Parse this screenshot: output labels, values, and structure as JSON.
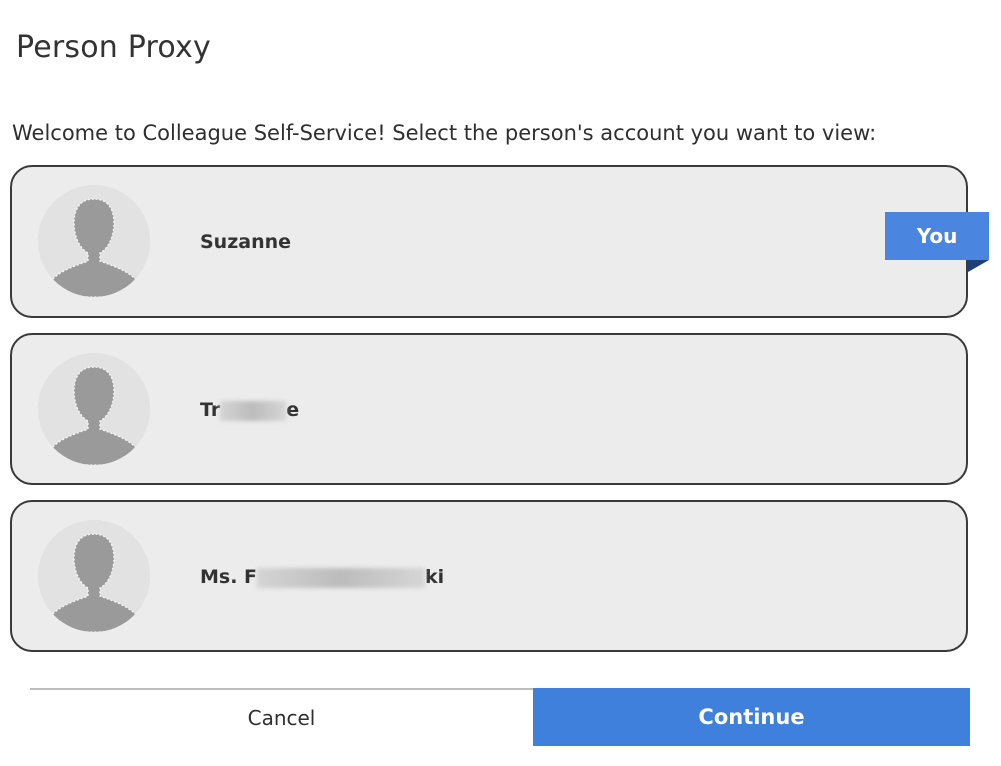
{
  "dialog": {
    "title": "Person Proxy",
    "prompt": "Welcome to Colleague Self-Service! Select the person's account you want to view:"
  },
  "people": [
    {
      "name_visible": "Suzanne",
      "avatar_icon": "default-person-silhouette-icon",
      "badge": "You"
    },
    {
      "name_prefix": "Tr",
      "name_suffix": "e",
      "avatar_icon": "default-person-silhouette-icon"
    },
    {
      "name_prefix": "Ms. F",
      "name_suffix": "ki",
      "avatar_icon": "default-person-silhouette-icon"
    }
  ],
  "actions": {
    "cancel_label": "Cancel",
    "continue_label": "Continue"
  },
  "colors": {
    "accent": "#3f80dc",
    "badge": "#4a86e0",
    "badge_fold": "#1e3f78",
    "card_bg": "#ececec",
    "card_border": "#3a3a3a"
  }
}
